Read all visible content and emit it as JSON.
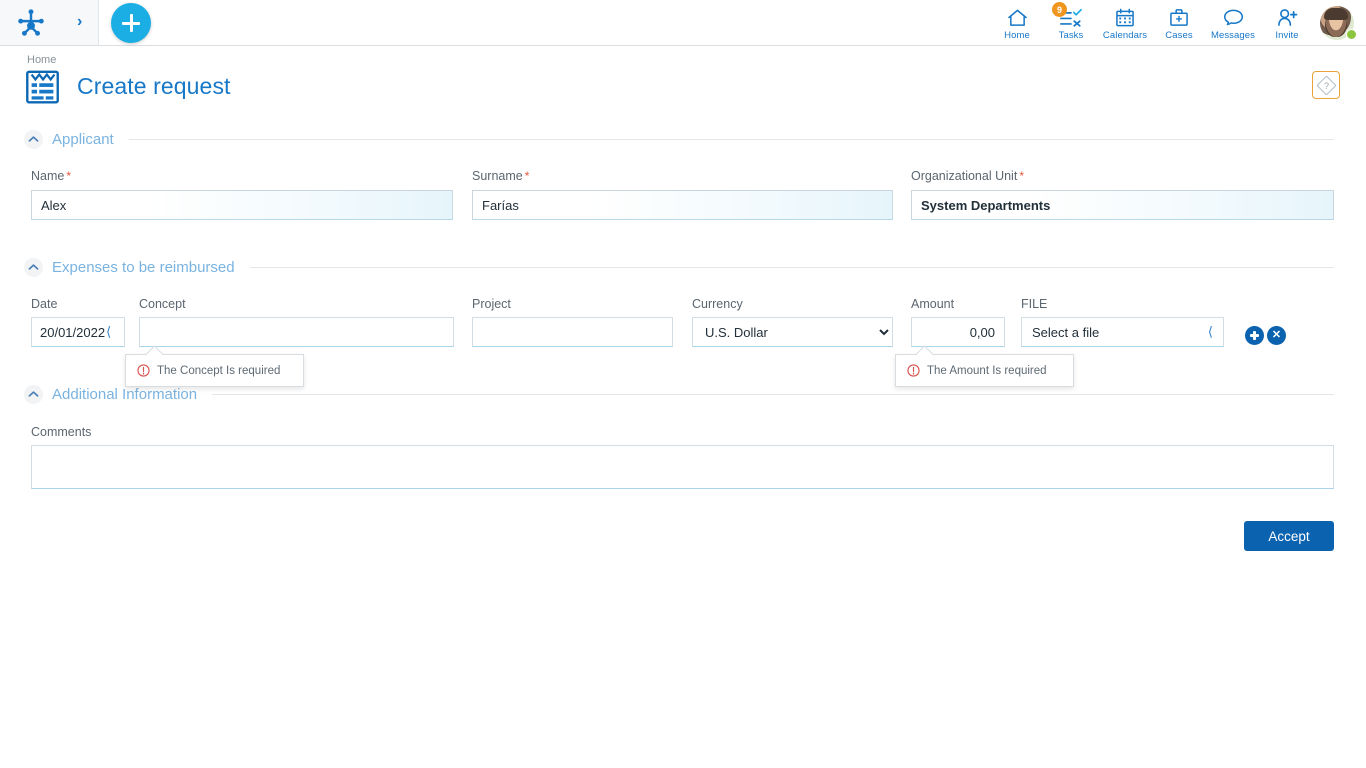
{
  "topbar": {
    "logo_icon": "flatworks-logo-icon",
    "expand_chevron_icon": "chevron-right-icon",
    "add_button_icon": "plus-icon",
    "nav": [
      {
        "label": "Home",
        "icon": "home-icon",
        "badge": null
      },
      {
        "label": "Tasks",
        "icon": "tasks-icon",
        "badge": "9"
      },
      {
        "label": "Calendars",
        "icon": "calendar-icon",
        "badge": null
      },
      {
        "label": "Cases",
        "icon": "briefcase-icon",
        "badge": null
      },
      {
        "label": "Messages",
        "icon": "chat-bubble-icon",
        "badge": null
      },
      {
        "label": "Invite",
        "icon": "person-add-icon",
        "badge": null
      }
    ],
    "avatar_name": "user-avatar",
    "status": "online"
  },
  "header": {
    "breadcrumb": "Home",
    "title": "Create request",
    "title_icon": "clipboard-form-icon",
    "help_icon": "help-diamond-icon"
  },
  "sections": {
    "applicant": {
      "title": "Applicant",
      "fields": {
        "name": {
          "label": "Name",
          "required": true,
          "value": "Alex"
        },
        "surname": {
          "label": "Surname",
          "required": true,
          "value": "Farías"
        },
        "org_unit": {
          "label": "Organizational Unit",
          "required": true,
          "value": "System Departments"
        }
      }
    },
    "expenses": {
      "title": "Expenses to be reimbursed",
      "columns": {
        "date": "Date",
        "concept": "Concept",
        "project": "Project",
        "currency": "Currency",
        "amount": "Amount",
        "file": "FILE"
      },
      "row": {
        "date": "20/01/2022",
        "date_caret_icon": "calendar-caret-icon",
        "concept": "",
        "project": "",
        "currency_selected": "U.S. Dollar",
        "currency_options": [
          "U.S. Dollar"
        ],
        "amount": "0,00",
        "file_placeholder": "Select a file",
        "file_caret_icon": "chevron-left-icon",
        "add_row_icon": "plus-circle-icon",
        "remove_row_icon": "close-circle-icon"
      },
      "validation": [
        {
          "for": "concept",
          "icon": "warning-circle-icon",
          "message": "The Concept Is required"
        },
        {
          "for": "amount",
          "icon": "warning-circle-icon",
          "message": "The Amount Is required"
        }
      ]
    },
    "additional": {
      "title": "Additional Information",
      "comments": {
        "label": "Comments",
        "value": ""
      }
    }
  },
  "footer": {
    "accept_label": "Accept"
  },
  "colors": {
    "brand_blue": "#1878c8",
    "accent_cyan": "#1aaee5",
    "action_blue": "#0b63b0",
    "badge_orange": "#f0961e",
    "required_red": "#e8553e",
    "status_green": "#8cc63f",
    "section_title": "#7ab3e0"
  }
}
